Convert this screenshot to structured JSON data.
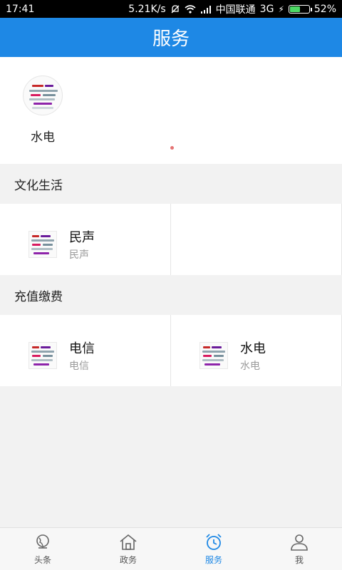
{
  "status": {
    "time": "17:41",
    "speed": "5.21K/s",
    "carrier": "中国联通",
    "network": "3G",
    "battery": "52%",
    "battery_level": 0.52
  },
  "header": {
    "title": "服务"
  },
  "featured": {
    "items": [
      {
        "label": "水电",
        "icon": "utility-thumbnail-icon"
      }
    ]
  },
  "sections": [
    {
      "title": "文化生活",
      "items": [
        {
          "title": "民声",
          "subtitle": "民声",
          "icon": "service-thumbnail-icon"
        }
      ]
    },
    {
      "title": "充值缴费",
      "items": [
        {
          "title": "电信",
          "subtitle": "电信",
          "icon": "service-thumbnail-icon"
        },
        {
          "title": "水电",
          "subtitle": "水电",
          "icon": "service-thumbnail-icon"
        }
      ]
    }
  ],
  "tabs": [
    {
      "label": "头条",
      "icon": "globe-icon"
    },
    {
      "label": "政务",
      "icon": "building-icon"
    },
    {
      "label": "服务",
      "icon": "alarm-clock-icon",
      "active": true
    },
    {
      "label": "我",
      "icon": "user-icon"
    }
  ],
  "colors": {
    "primary": "#1e88e5",
    "indicator": "#e57373"
  }
}
